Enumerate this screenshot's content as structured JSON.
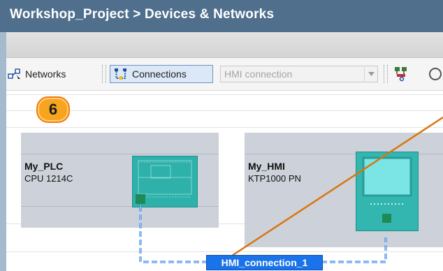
{
  "window": {
    "title": "Workshop_Project > Devices & Networks"
  },
  "toolbar": {
    "networks_label": "Networks",
    "connections_label": "Connections",
    "connection_type_value": "HMI connection"
  },
  "step_badge": "6",
  "devices": [
    {
      "name": "My_PLC",
      "type": "CPU 1214C",
      "image": "plc-module-icon"
    },
    {
      "name": "My_HMI",
      "type": "KTP1000 PN",
      "image": "hmi-panel-icon"
    }
  ],
  "connection": {
    "name": "HMI_connection_1"
  },
  "colors": {
    "title_bar": "#4f6f8c",
    "frame_border": "#a6bacd",
    "device_body": "#cdd1d9",
    "device_image_teal": "#2fb1ab",
    "connection_line_blue": "#1a73e8",
    "badge_orange": "#f7a51e",
    "callout_line": "#d9760f"
  }
}
